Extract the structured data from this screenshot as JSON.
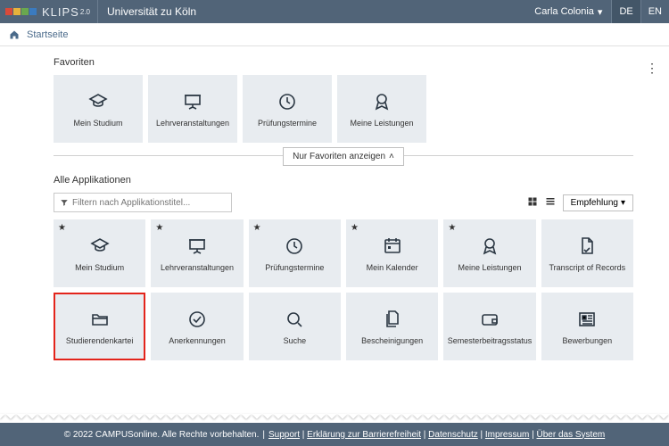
{
  "header": {
    "brand": "KLIPS",
    "brand_version": "2.0",
    "university": "Universität zu Köln",
    "user": "Carla Colonia",
    "lang_de": "DE",
    "lang_en": "EN"
  },
  "breadcrumb": {
    "home": "Startseite"
  },
  "favorites": {
    "title": "Favoriten",
    "items": [
      {
        "label": "Mein Studium",
        "icon": "graduation"
      },
      {
        "label": "Lehrveranstaltungen",
        "icon": "presentation"
      },
      {
        "label": "Prüfungstermine",
        "icon": "clock"
      },
      {
        "label": "Meine Leistungen",
        "icon": "ribbon"
      }
    ]
  },
  "collapse": {
    "label": "Nur Favoriten anzeigen"
  },
  "apps": {
    "title": "Alle Applikationen",
    "filter_placeholder": "Filtern nach Applikationstitel...",
    "sort_label": "Empfehlung",
    "items": [
      {
        "label": "Mein Studium",
        "icon": "graduation",
        "starred": true
      },
      {
        "label": "Lehrveranstaltungen",
        "icon": "presentation",
        "starred": true
      },
      {
        "label": "Prüfungstermine",
        "icon": "clock",
        "starred": true
      },
      {
        "label": "Mein Kalender",
        "icon": "calendar",
        "starred": true
      },
      {
        "label": "Meine Leistungen",
        "icon": "ribbon",
        "starred": true
      },
      {
        "label": "Transcript of Records",
        "icon": "doc"
      },
      {
        "label": "Studierendenkartei",
        "icon": "folder",
        "highlight": true
      },
      {
        "label": "Anerkennungen",
        "icon": "check"
      },
      {
        "label": "Suche",
        "icon": "search"
      },
      {
        "label": "Bescheinigungen",
        "icon": "files"
      },
      {
        "label": "Semesterbeitragsstatus",
        "icon": "wallet"
      },
      {
        "label": "Bewerbungen",
        "icon": "news"
      }
    ]
  },
  "footer": {
    "copyright": "© 2022 CAMPUSonline. Alle Rechte vorbehalten.",
    "links": [
      "Support",
      "Erklärung zur Barrierefreiheit",
      "Datenschutz",
      "Impressum",
      "Über das System"
    ]
  },
  "colors": {
    "bar": "#516478",
    "tile": "#e8ecf0",
    "highlight": "#e3241b"
  }
}
